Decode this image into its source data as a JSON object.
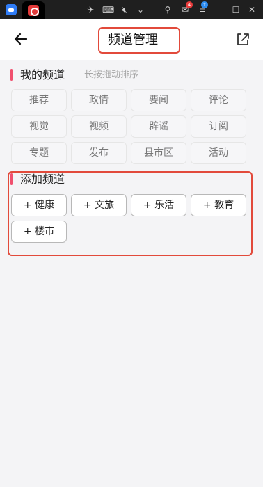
{
  "chrome": {
    "icons": [
      "app-icon",
      "app-tab-icon",
      "pin-icon",
      "keyboard-icon",
      "mute-icon",
      "chevron-down-icon",
      "user-icon",
      "mail-icon",
      "menu-icon",
      "minimize-icon",
      "maximize-icon",
      "close-icon"
    ],
    "mail_badge": "4",
    "update_badge": "↑"
  },
  "header": {
    "title": "频道管理",
    "back_icon": "arrow-left-icon",
    "share_icon": "share-icon"
  },
  "my_channels": {
    "title": "我的频道",
    "hint": "长按拖动排序",
    "items": [
      "推荐",
      "政情",
      "要闻",
      "评论",
      "视觉",
      "视频",
      "辟谣",
      "订阅",
      "专题",
      "发布",
      "县市区",
      "活动"
    ]
  },
  "add_channels": {
    "title": "添加频道",
    "items": [
      "+ 健康",
      "+ 文旅",
      "+ 乐活",
      "+ 教育",
      "+ 楼市"
    ]
  },
  "colors": {
    "accent": "#f0506e",
    "highlight_box": "#e24a3b"
  }
}
